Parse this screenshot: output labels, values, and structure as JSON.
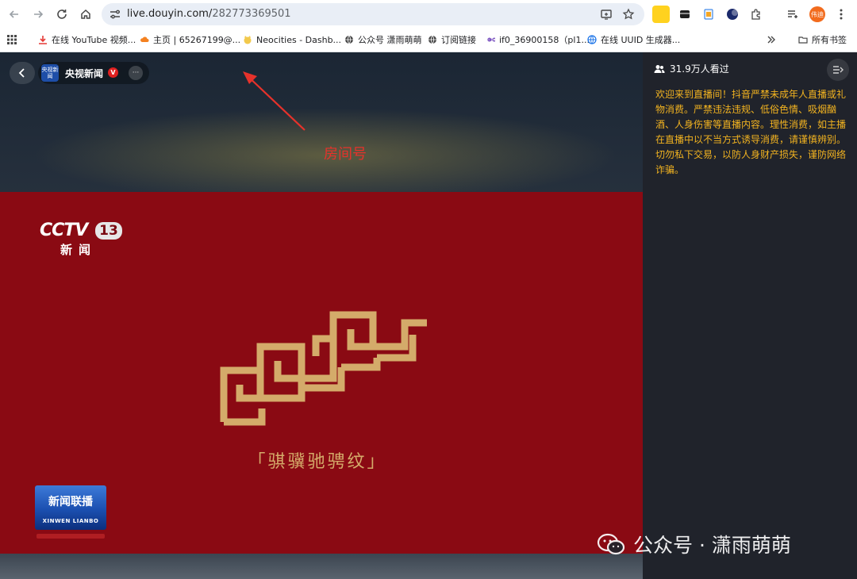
{
  "browser": {
    "url_host": "live.douyin.com/",
    "url_path": "282773369501",
    "bookmarks": [
      {
        "label": "在线 YouTube 视频...",
        "icon": "download-icon"
      },
      {
        "label": "主页 | 65267199@...",
        "icon": "cloud-icon"
      },
      {
        "label": "Neocities - Dashb...",
        "icon": "cat-icon"
      },
      {
        "label": "公众号 潇雨萌萌",
        "icon": "globe-icon"
      },
      {
        "label": "订阅链接",
        "icon": "globe-icon"
      },
      {
        "label": "if0_36900158（pl1...",
        "icon": "infinity-icon"
      },
      {
        "label": "在线 UUID 生成器...",
        "icon": "globe-icon"
      }
    ],
    "all_bookmarks_label": "所有书签",
    "profile_label": "伟迪"
  },
  "stream": {
    "anchor_avatar_text": "央视新闻",
    "anchor_name": "央视新闻",
    "verified_mark": "V",
    "more_label": "···",
    "channel_logo": "CCTV",
    "channel_number": "13",
    "channel_sub": "新闻",
    "pattern_caption": "「骐骥驰骋纹」",
    "program_logo_title": "新闻联播",
    "program_logo_pinyin": "XINWEN LIANBO"
  },
  "annotation": {
    "label": "房间号",
    "color": "#e6322b"
  },
  "sidebar": {
    "viewers": "31.9万人看过",
    "notice": "欢迎来到直播间！抖音严禁未成年人直播或礼物消费。严禁违法违规、低俗色情、吸烟酗酒、人身伤害等直播内容。理性消费，如主播在直播中以不当方式诱导消费，请谨慎辨别。切勿私下交易，以防人身财产损失，谨防网络诈骗。",
    "notice_color": "#f2b320"
  },
  "watermark": {
    "text": "公众号 · 潇雨萌萌"
  },
  "colors": {
    "stage_red": "#8a0a13",
    "pattern_gold": "#d4ab6a",
    "sidebar_bg": "#20232b"
  }
}
